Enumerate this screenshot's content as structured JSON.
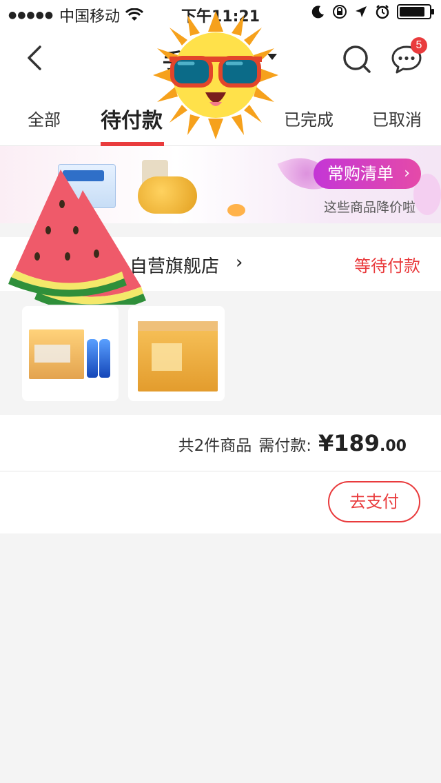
{
  "status_bar": {
    "signal_dots": "●●●●●",
    "carrier": "中国移动",
    "time": "下午11:21",
    "battery_level": 0.8
  },
  "nav": {
    "title_visible_fragment": "手",
    "message_badge": "5"
  },
  "tabs": {
    "all": "全部",
    "pending_payment": "待付款",
    "completed": "已完成",
    "cancelled": "已取消",
    "active": "待付款"
  },
  "banner": {
    "button_label": "常购清单",
    "button_chevron": "›",
    "subtitle": "这些商品降价啦"
  },
  "order": {
    "store_name": "自营旗舰店",
    "store_chevron": "›",
    "status": "等待付款",
    "item_count_text": "共2件商品",
    "need_pay_label": "需付款:",
    "price_main": "¥189",
    "price_cents": ".00",
    "pay_button": "去支付"
  },
  "colors": {
    "accent": "#e93b3d",
    "banner_button": "#d63fc0"
  }
}
